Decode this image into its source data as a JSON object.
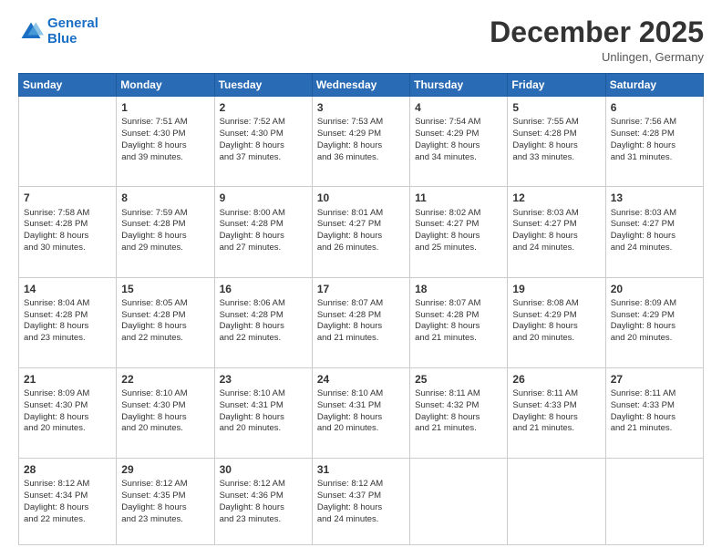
{
  "logo": {
    "line1": "General",
    "line2": "Blue"
  },
  "title": "December 2025",
  "subtitle": "Unlingen, Germany",
  "days_header": [
    "Sunday",
    "Monday",
    "Tuesday",
    "Wednesday",
    "Thursday",
    "Friday",
    "Saturday"
  ],
  "weeks": [
    [
      {
        "day": "",
        "info": ""
      },
      {
        "day": "1",
        "info": "Sunrise: 7:51 AM\nSunset: 4:30 PM\nDaylight: 8 hours\nand 39 minutes."
      },
      {
        "day": "2",
        "info": "Sunrise: 7:52 AM\nSunset: 4:30 PM\nDaylight: 8 hours\nand 37 minutes."
      },
      {
        "day": "3",
        "info": "Sunrise: 7:53 AM\nSunset: 4:29 PM\nDaylight: 8 hours\nand 36 minutes."
      },
      {
        "day": "4",
        "info": "Sunrise: 7:54 AM\nSunset: 4:29 PM\nDaylight: 8 hours\nand 34 minutes."
      },
      {
        "day": "5",
        "info": "Sunrise: 7:55 AM\nSunset: 4:28 PM\nDaylight: 8 hours\nand 33 minutes."
      },
      {
        "day": "6",
        "info": "Sunrise: 7:56 AM\nSunset: 4:28 PM\nDaylight: 8 hours\nand 31 minutes."
      }
    ],
    [
      {
        "day": "7",
        "info": "Sunrise: 7:58 AM\nSunset: 4:28 PM\nDaylight: 8 hours\nand 30 minutes."
      },
      {
        "day": "8",
        "info": "Sunrise: 7:59 AM\nSunset: 4:28 PM\nDaylight: 8 hours\nand 29 minutes."
      },
      {
        "day": "9",
        "info": "Sunrise: 8:00 AM\nSunset: 4:28 PM\nDaylight: 8 hours\nand 27 minutes."
      },
      {
        "day": "10",
        "info": "Sunrise: 8:01 AM\nSunset: 4:27 PM\nDaylight: 8 hours\nand 26 minutes."
      },
      {
        "day": "11",
        "info": "Sunrise: 8:02 AM\nSunset: 4:27 PM\nDaylight: 8 hours\nand 25 minutes."
      },
      {
        "day": "12",
        "info": "Sunrise: 8:03 AM\nSunset: 4:27 PM\nDaylight: 8 hours\nand 24 minutes."
      },
      {
        "day": "13",
        "info": "Sunrise: 8:03 AM\nSunset: 4:27 PM\nDaylight: 8 hours\nand 24 minutes."
      }
    ],
    [
      {
        "day": "14",
        "info": "Sunrise: 8:04 AM\nSunset: 4:28 PM\nDaylight: 8 hours\nand 23 minutes."
      },
      {
        "day": "15",
        "info": "Sunrise: 8:05 AM\nSunset: 4:28 PM\nDaylight: 8 hours\nand 22 minutes."
      },
      {
        "day": "16",
        "info": "Sunrise: 8:06 AM\nSunset: 4:28 PM\nDaylight: 8 hours\nand 22 minutes."
      },
      {
        "day": "17",
        "info": "Sunrise: 8:07 AM\nSunset: 4:28 PM\nDaylight: 8 hours\nand 21 minutes."
      },
      {
        "day": "18",
        "info": "Sunrise: 8:07 AM\nSunset: 4:28 PM\nDaylight: 8 hours\nand 21 minutes."
      },
      {
        "day": "19",
        "info": "Sunrise: 8:08 AM\nSunset: 4:29 PM\nDaylight: 8 hours\nand 20 minutes."
      },
      {
        "day": "20",
        "info": "Sunrise: 8:09 AM\nSunset: 4:29 PM\nDaylight: 8 hours\nand 20 minutes."
      }
    ],
    [
      {
        "day": "21",
        "info": "Sunrise: 8:09 AM\nSunset: 4:30 PM\nDaylight: 8 hours\nand 20 minutes."
      },
      {
        "day": "22",
        "info": "Sunrise: 8:10 AM\nSunset: 4:30 PM\nDaylight: 8 hours\nand 20 minutes."
      },
      {
        "day": "23",
        "info": "Sunrise: 8:10 AM\nSunset: 4:31 PM\nDaylight: 8 hours\nand 20 minutes."
      },
      {
        "day": "24",
        "info": "Sunrise: 8:10 AM\nSunset: 4:31 PM\nDaylight: 8 hours\nand 20 minutes."
      },
      {
        "day": "25",
        "info": "Sunrise: 8:11 AM\nSunset: 4:32 PM\nDaylight: 8 hours\nand 21 minutes."
      },
      {
        "day": "26",
        "info": "Sunrise: 8:11 AM\nSunset: 4:33 PM\nDaylight: 8 hours\nand 21 minutes."
      },
      {
        "day": "27",
        "info": "Sunrise: 8:11 AM\nSunset: 4:33 PM\nDaylight: 8 hours\nand 21 minutes."
      }
    ],
    [
      {
        "day": "28",
        "info": "Sunrise: 8:12 AM\nSunset: 4:34 PM\nDaylight: 8 hours\nand 22 minutes."
      },
      {
        "day": "29",
        "info": "Sunrise: 8:12 AM\nSunset: 4:35 PM\nDaylight: 8 hours\nand 23 minutes."
      },
      {
        "day": "30",
        "info": "Sunrise: 8:12 AM\nSunset: 4:36 PM\nDaylight: 8 hours\nand 23 minutes."
      },
      {
        "day": "31",
        "info": "Sunrise: 8:12 AM\nSunset: 4:37 PM\nDaylight: 8 hours\nand 24 minutes."
      },
      {
        "day": "",
        "info": ""
      },
      {
        "day": "",
        "info": ""
      },
      {
        "day": "",
        "info": ""
      }
    ]
  ]
}
